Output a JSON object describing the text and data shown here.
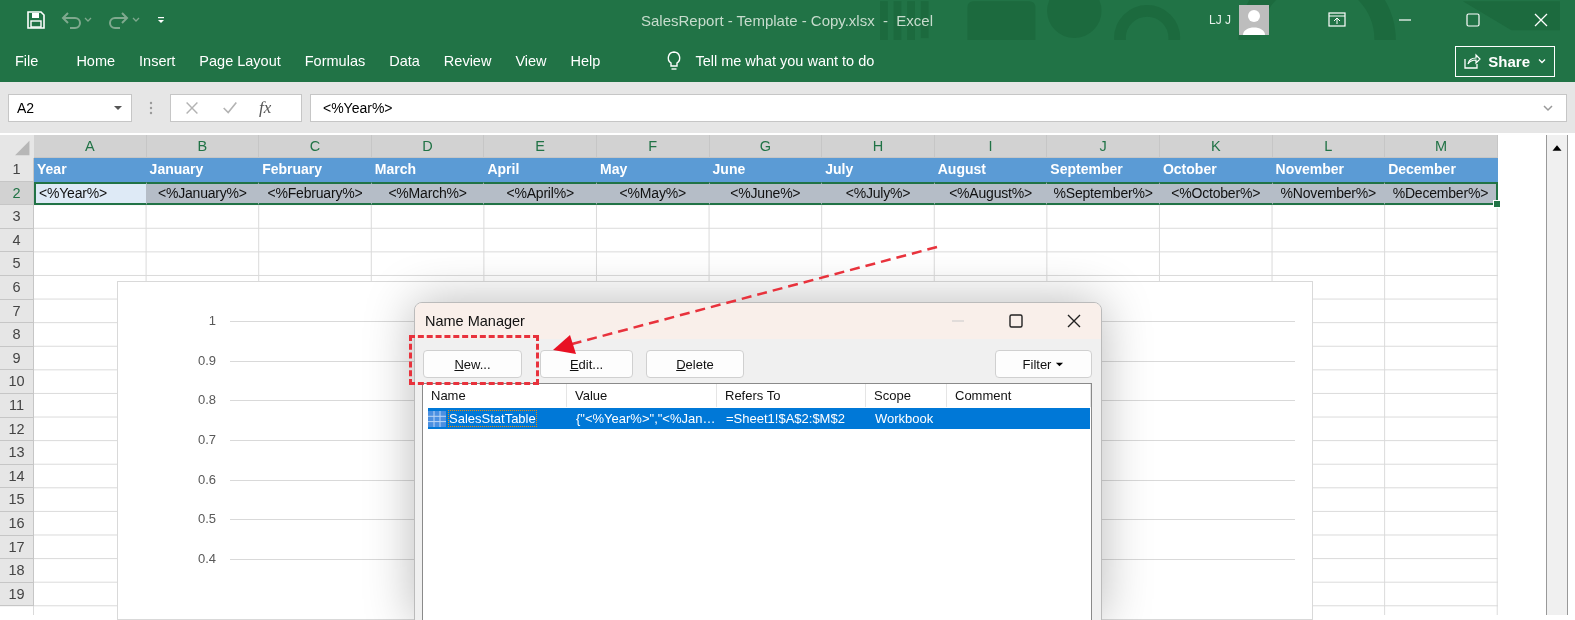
{
  "window": {
    "title": "SalesReport - Template - Copy.xlsx  -  Excel",
    "user": "LJ J"
  },
  "ribbon_tabs": [
    {
      "label": "File"
    },
    {
      "label": "Home"
    },
    {
      "label": "Insert"
    },
    {
      "label": "Page Layout"
    },
    {
      "label": "Formulas"
    },
    {
      "label": "Data"
    },
    {
      "label": "Review"
    },
    {
      "label": "View"
    },
    {
      "label": "Help"
    }
  ],
  "tell_me": {
    "placeholder": "Tell me what you want to do"
  },
  "share_button": "Share",
  "name_box": {
    "value": "A2"
  },
  "formula_bar": {
    "function_label": "fx",
    "value": "<%Year%>"
  },
  "sheet": {
    "columns": [
      "A",
      "B",
      "C",
      "D",
      "E",
      "F",
      "G",
      "H",
      "I",
      "J",
      "K",
      "L",
      "M"
    ],
    "rows": [
      {
        "header": "1",
        "kind": "header",
        "selected": false,
        "cells": [
          {
            "text": "Year"
          },
          {
            "text": "January"
          },
          {
            "text": "February"
          },
          {
            "text": "March"
          },
          {
            "text": "April"
          },
          {
            "text": "May"
          },
          {
            "text": "June"
          },
          {
            "text": "July"
          },
          {
            "text": "August"
          },
          {
            "text": "September"
          },
          {
            "text": "October"
          },
          {
            "text": "November"
          },
          {
            "text": "December"
          }
        ]
      },
      {
        "header": "2",
        "kind": "data",
        "selected": true,
        "cells": [
          {
            "text": "<%Year%>",
            "active": true
          },
          {
            "text": "<%January%>",
            "active": false
          },
          {
            "text": "<%February%>",
            "active": false
          },
          {
            "text": "<%March%>",
            "active": false
          },
          {
            "text": "<%April%>",
            "active": false
          },
          {
            "text": "<%May%>",
            "active": false
          },
          {
            "text": "<%June%>",
            "active": false
          },
          {
            "text": "<%July%>",
            "active": false
          },
          {
            "text": "<%August%>",
            "active": false
          },
          {
            "text": "%September%>",
            "active": false
          },
          {
            "text": "<%October%>",
            "active": false
          },
          {
            "text": "%November%>",
            "active": false
          },
          {
            "text": "%December%>",
            "active": false
          }
        ]
      },
      {
        "header": "3",
        "kind": "empty",
        "selected": false
      },
      {
        "header": "4",
        "kind": "empty",
        "selected": false
      },
      {
        "header": "5",
        "kind": "empty",
        "selected": false
      },
      {
        "header": "6",
        "kind": "empty",
        "selected": false
      },
      {
        "header": "7",
        "kind": "empty",
        "selected": false
      },
      {
        "header": "8",
        "kind": "empty",
        "selected": false
      },
      {
        "header": "9",
        "kind": "empty",
        "selected": false
      },
      {
        "header": "10",
        "kind": "empty",
        "selected": false
      },
      {
        "header": "11",
        "kind": "empty",
        "selected": false
      },
      {
        "header": "12",
        "kind": "empty",
        "selected": false
      },
      {
        "header": "13",
        "kind": "empty",
        "selected": false
      },
      {
        "header": "14",
        "kind": "empty",
        "selected": false
      },
      {
        "header": "15",
        "kind": "empty",
        "selected": false
      },
      {
        "header": "16",
        "kind": "empty",
        "selected": false
      },
      {
        "header": "17",
        "kind": "empty",
        "selected": false
      },
      {
        "header": "18",
        "kind": "empty",
        "selected": false
      },
      {
        "header": "19",
        "kind": "empty",
        "selected": false
      }
    ]
  },
  "chart": {
    "y_axis_labels": [
      "1",
      "0.9",
      "0.8",
      "0.7",
      "0.6",
      "0.5",
      "0.4"
    ]
  },
  "dialog": {
    "title": "Name Manager",
    "buttons": [
      {
        "label": "New..."
      },
      {
        "label": "Edit..."
      },
      {
        "label": "Delete"
      }
    ],
    "filter_button": "Filter",
    "list": {
      "columns": [
        "Name",
        "Value",
        "Refers To",
        "Scope",
        "Comment"
      ],
      "rows": [
        {
          "selected": true,
          "cells": [
            "SalesStatTable",
            "{\"<%Year%>\",\"<%Jan…",
            "=Sheet1!$A$2:$M$2",
            "Workbook"
          ]
        }
      ]
    }
  }
}
